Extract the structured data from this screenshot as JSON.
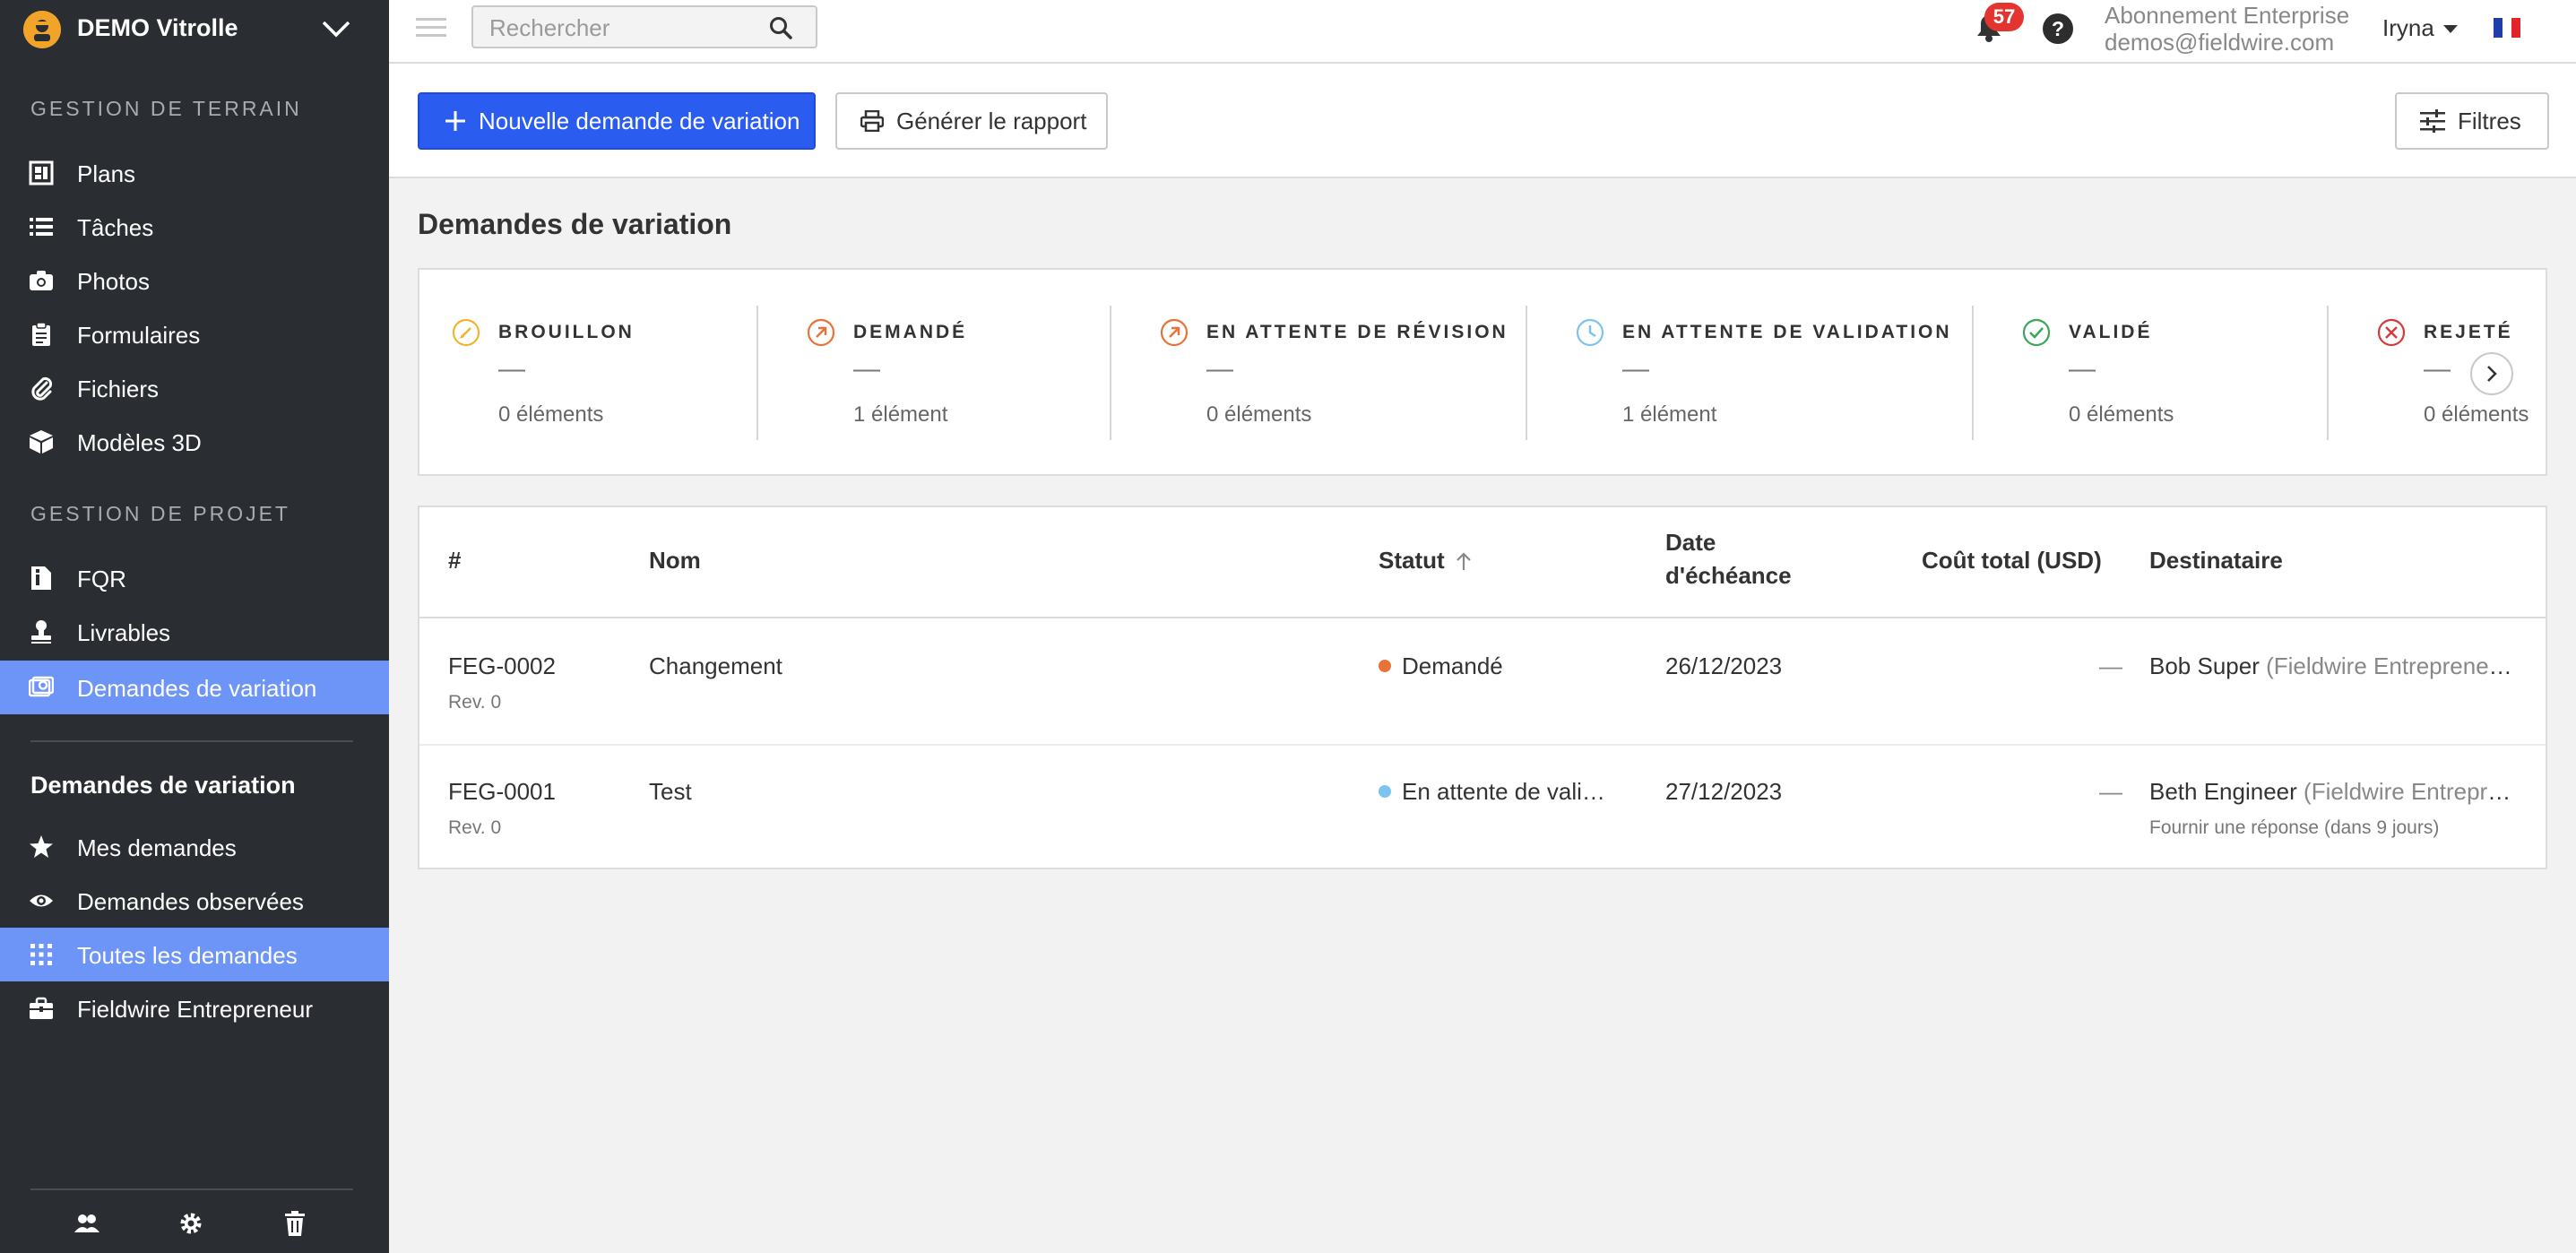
{
  "colors": {
    "sidebar_bg": "#2a2d31",
    "sidebar_active": "#6d94f7",
    "primary": "#2b5cf0",
    "badge": "#e3342f",
    "status_draft": "#f2b430",
    "status_requested": "#e8733a",
    "status_pending_review": "#e8733a",
    "status_pending_validation": "#7cc4ef",
    "status_validated": "#3aa75a",
    "status_rejected": "#d23b3b"
  },
  "sidebar": {
    "project_name": "DEMO Vitrolle",
    "field_heading": "GESTION DE TERRAIN",
    "field_items": [
      {
        "label": "Plans",
        "icon": "plans-icon"
      },
      {
        "label": "Tâches",
        "icon": "tasks-list-icon"
      },
      {
        "label": "Photos",
        "icon": "camera-icon"
      },
      {
        "label": "Formulaires",
        "icon": "clipboard-icon"
      },
      {
        "label": "Fichiers",
        "icon": "paperclip-icon"
      },
      {
        "label": "Modèles 3D",
        "icon": "cube-icon"
      }
    ],
    "project_heading": "GESTION DE PROJET",
    "project_items": [
      {
        "label": "FQR",
        "icon": "info-doc-icon"
      },
      {
        "label": "Livrables",
        "icon": "stamp-icon"
      },
      {
        "label": "Demandes de variation",
        "icon": "change-order-icon",
        "active": true
      }
    ],
    "sub_title": "Demandes de variation",
    "sub_items": [
      {
        "label": "Mes demandes",
        "icon": "star-icon"
      },
      {
        "label": "Demandes observées",
        "icon": "eye-icon"
      },
      {
        "label": "Toutes les demandes",
        "icon": "grid-icon",
        "active": true
      },
      {
        "label": "Fieldwire Entrepreneur",
        "icon": "briefcase-icon"
      }
    ],
    "footer_icons": [
      "people-icon",
      "gear-icon",
      "trash-icon"
    ]
  },
  "topbar": {
    "search_placeholder": "Rechercher",
    "notification_count": "57",
    "subscription": "Abonnement Enterprise",
    "email": "demos@fieldwire.com",
    "user": "Iryna",
    "language_flag": "french-flag-icon"
  },
  "actions": {
    "new_request": "Nouvelle demande de variation",
    "generate_report": "Générer le rapport",
    "filters": "Filtres"
  },
  "page_title": "Demandes de variation",
  "statuses": [
    {
      "label": "BROUILLON",
      "value": "—",
      "count": "0 éléments",
      "icon": "pencil-circle-icon"
    },
    {
      "label": "DEMANDÉ",
      "value": "—",
      "count": "1 élément",
      "icon": "arrow-up-right-circle-icon"
    },
    {
      "label": "EN ATTENTE DE RÉVISION",
      "value": "—",
      "count": "0 éléments",
      "icon": "arrow-up-right-circle-icon"
    },
    {
      "label": "EN ATTENTE DE VALIDATION",
      "value": "—",
      "count": "1 élément",
      "icon": "clock-icon"
    },
    {
      "label": "VALIDÉ",
      "value": "—",
      "count": "0 éléments",
      "icon": "check-circle-icon"
    },
    {
      "label": "REJETÉ",
      "value": "—",
      "count": "0 éléments",
      "icon": "x-circle-icon"
    }
  ],
  "table": {
    "headers": {
      "number": "#",
      "name": "Nom",
      "status": "Statut",
      "due_line1": "Date",
      "due_line2": "d'échéance",
      "cost": "Coût total (USD)",
      "recipient": "Destinataire"
    },
    "rows": [
      {
        "number": "FEG-0002",
        "rev": "Rev. 0",
        "name": "Changement",
        "status": "Demandé",
        "due": "26/12/2023",
        "cost": "—",
        "recipient": "Bob Super",
        "recipient_org": "(Fieldwire Entrepreneu…",
        "note": ""
      },
      {
        "number": "FEG-0001",
        "rev": "Rev. 0",
        "name": "Test",
        "status": "En attente de vali…",
        "due": "27/12/2023",
        "cost": "—",
        "recipient": "Beth Engineer",
        "recipient_org": "(Fieldwire Entrepre…",
        "note": "Fournir une réponse (dans 9 jours)"
      }
    ]
  }
}
